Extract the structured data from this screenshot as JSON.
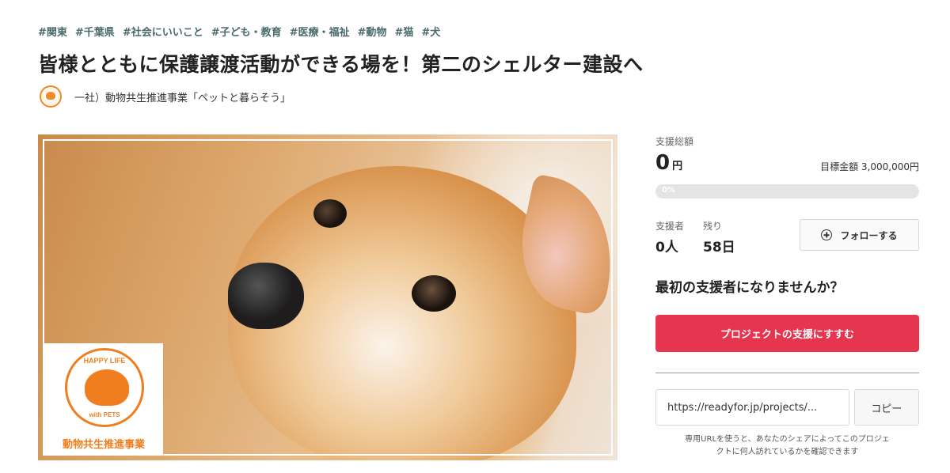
{
  "tags": [
    "#関東",
    "#千葉県",
    "#社会にいいこと",
    "#子ども・教育",
    "#医療・福祉",
    "#動物",
    "#猫",
    "#犬"
  ],
  "project": {
    "title": "皆様とともに保護譲渡活動ができる場を！第二のシェルター建設へ",
    "owner": "一社）動物共生推進事業「ペットと暮らそう」"
  },
  "hero": {
    "logo_top": "HAPPY LIFE",
    "logo_bottom": "with PETS",
    "logo_text": "動物共生推進事業"
  },
  "funding": {
    "total_label": "支援総額",
    "total_amount": "0",
    "total_unit": "円",
    "goal_text": "目標金額 3,000,000円",
    "progress_percent": 0,
    "progress_text": "0%",
    "supporters_label": "支援者",
    "supporters_value": "0人",
    "remaining_label": "残り",
    "remaining_value": "58日",
    "follow_label": "フォローする",
    "cta_heading": "最初の支援者になりませんか？",
    "support_button": "プロジェクトの支援にすすむ"
  },
  "share": {
    "url": "https://readyfor.jp/projects/...",
    "copy_label": "コピー",
    "note_line1": "専用URLを使うと、あなたのシェアによってこのプロジェ",
    "note_line2": "クトに何人訪れているかを確認できます"
  },
  "colors": {
    "accent": "#e6354f",
    "tag": "#4a6b6b",
    "logo_orange": "#f07e1e"
  },
  "icons": {
    "follow": "plus-circle-icon"
  }
}
